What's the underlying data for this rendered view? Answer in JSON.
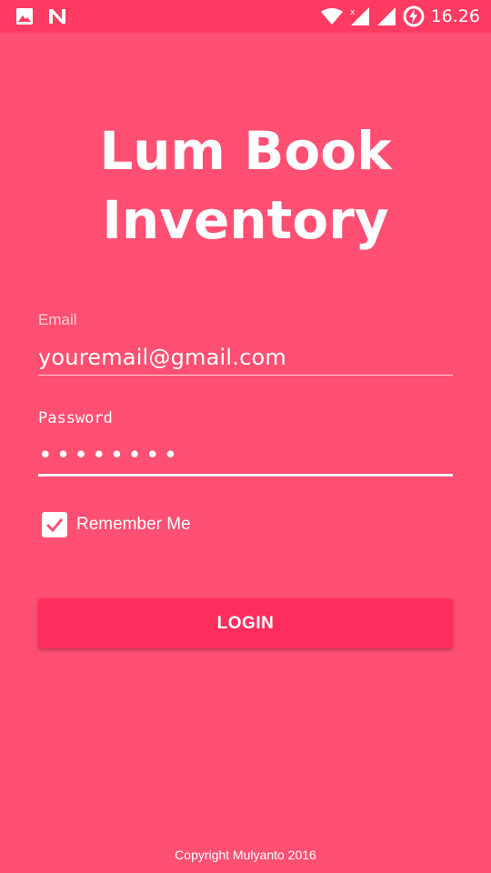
{
  "colors": {
    "background": "#ff4f72",
    "status_bar": "#ff3a63",
    "button": "#ff2d5e",
    "text": "#ffffff"
  },
  "status_bar": {
    "time": "16.26",
    "icons": [
      "image-icon",
      "n-notification-icon",
      "wifi-icon",
      "cell-signal-no-data-icon",
      "cell-signal-icon",
      "battery-charging-icon"
    ]
  },
  "app": {
    "title_line1": "Lum Book",
    "title_line2": "Inventory"
  },
  "form": {
    "email_label": "Email",
    "email_value": "youremail@gmail.com",
    "password_label": "Password",
    "password_value": "••••••••",
    "remember_label": "Remember Me",
    "remember_checked": true,
    "login_label": "LOGIN"
  },
  "footer": {
    "copyright": "Copyright Mulyanto 2016"
  }
}
